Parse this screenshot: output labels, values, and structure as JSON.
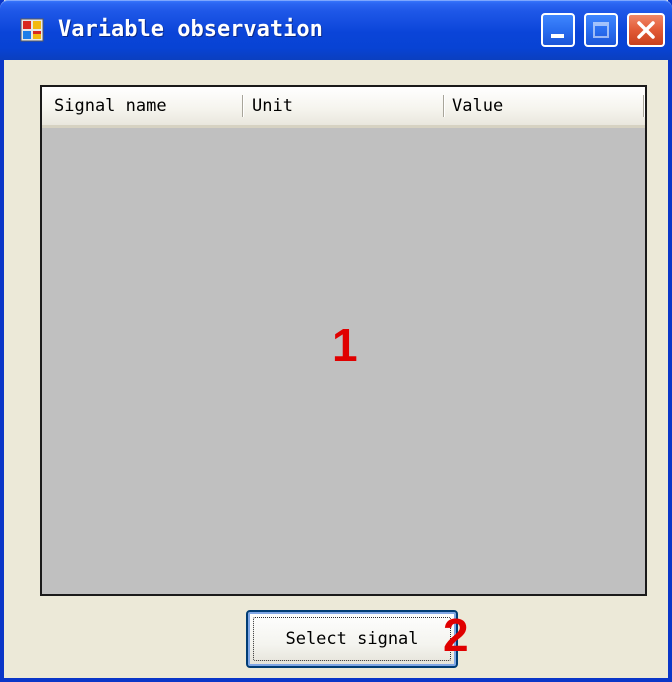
{
  "window": {
    "title": "Variable observation",
    "icons": {
      "app": "app-window-icon",
      "minimize": "minimize-icon",
      "maximize": "maximize-icon",
      "close": "close-icon"
    },
    "colors": {
      "titlebar": "#0a44d8",
      "client_background": "#ece9d8",
      "list_background": "#c0c0c0",
      "close_button": "#e25a36",
      "annotation": "#e00000"
    }
  },
  "signal_list": {
    "columns": [
      {
        "label": "Signal name"
      },
      {
        "label": "Unit"
      },
      {
        "label": "Value"
      }
    ],
    "rows": []
  },
  "annotations": {
    "list_marker": "1",
    "button_marker": "2"
  },
  "actions": {
    "select_signal_label": "Select signal"
  }
}
